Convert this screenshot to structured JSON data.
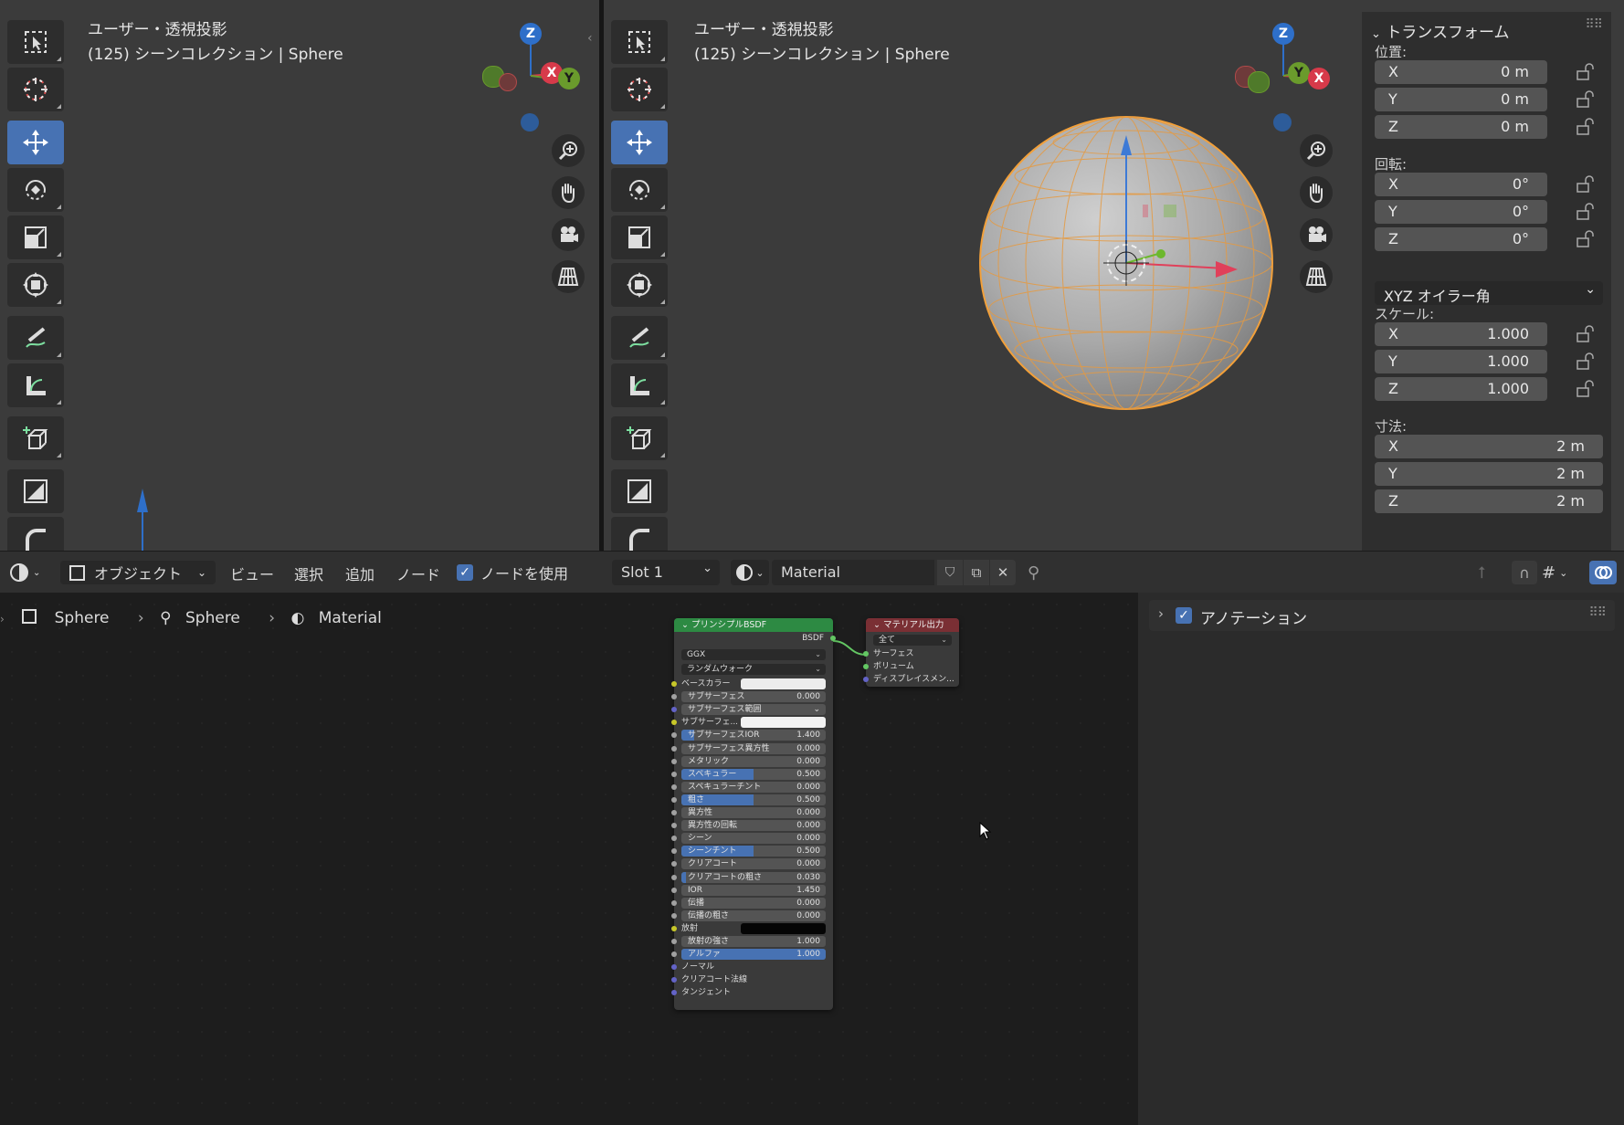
{
  "left_viewport": {
    "view_label": "ユーザー・透視投影",
    "collection_label": "(125) シーンコレクション | Sphere"
  },
  "right_viewport": {
    "view_label": "ユーザー・透視投影",
    "collection_label": "(125) シーンコレクション | Sphere"
  },
  "gizmo": {
    "z": "Z",
    "x": "X",
    "y": "Y"
  },
  "tools": [
    "select-box-icon",
    "cursor-icon",
    "move-icon",
    "rotate-icon",
    "scale-icon",
    "transform-icon",
    "annotate-icon",
    "measure-icon",
    "add-cube-icon",
    "shrink-icon",
    "bevel-icon"
  ],
  "nav_buttons": [
    "zoom-icon",
    "pan-hand-icon",
    "camera-icon",
    "perspective-grid-icon"
  ],
  "transform_panel": {
    "title": "トランスフォーム",
    "location_label": "位置:",
    "location": [
      {
        "axis": "X",
        "value": "0 m"
      },
      {
        "axis": "Y",
        "value": "0 m"
      },
      {
        "axis": "Z",
        "value": "0 m"
      }
    ],
    "rotation_label": "回転:",
    "rotation": [
      {
        "axis": "X",
        "value": "0°"
      },
      {
        "axis": "Y",
        "value": "0°"
      },
      {
        "axis": "Z",
        "value": "0°"
      }
    ],
    "rotation_mode": "XYZ オイラー角",
    "scale_label": "スケール:",
    "scale": [
      {
        "axis": "X",
        "value": "1.000"
      },
      {
        "axis": "Y",
        "value": "1.000"
      },
      {
        "axis": "Z",
        "value": "1.000"
      }
    ],
    "dimensions_label": "寸法:",
    "dimensions": [
      {
        "axis": "X",
        "value": "2 m"
      },
      {
        "axis": "Y",
        "value": "2 m"
      },
      {
        "axis": "Z",
        "value": "2 m"
      }
    ]
  },
  "node_header": {
    "object_mode": "オブジェクト",
    "menu": [
      "ビュー",
      "選択",
      "追加",
      "ノード"
    ],
    "use_nodes_label": "ノードを使用",
    "use_nodes_checked": true,
    "slot": "Slot 1",
    "material_name": "Material"
  },
  "breadcrumb": {
    "object": "Sphere",
    "mesh": "Sphere",
    "material": "Material"
  },
  "annotation_panel": {
    "label": "アノテーション",
    "checked": true
  },
  "bsdf_node": {
    "title": "プリンシプルBSDF",
    "output": "BSDF",
    "distribution": "GGX",
    "subsurface_method": "ランダムウォーク",
    "inputs": [
      {
        "label": "ベースカラー",
        "kind": "color",
        "color": "#ececec"
      },
      {
        "label": "サブサーフェス",
        "kind": "value",
        "value": "0.000",
        "fill": 0
      },
      {
        "label": "サブサーフェス範囲",
        "kind": "select"
      },
      {
        "label": "サブサーフェ...",
        "kind": "color",
        "color": "#f2f2f2"
      },
      {
        "label": "サブサーフェスIOR",
        "kind": "value",
        "value": "1.400",
        "fill": 0.09
      },
      {
        "label": "サブサーフェス異方性",
        "kind": "value",
        "value": "0.000",
        "fill": 0
      },
      {
        "label": "メタリック",
        "kind": "value",
        "value": "0.000",
        "fill": 0
      },
      {
        "label": "スペキュラー",
        "kind": "value",
        "value": "0.500",
        "fill": 0.5
      },
      {
        "label": "スペキュラーチント",
        "kind": "value",
        "value": "0.000",
        "fill": 0
      },
      {
        "label": "粗さ",
        "kind": "value",
        "value": "0.500",
        "fill": 0.5
      },
      {
        "label": "異方性",
        "kind": "value",
        "value": "0.000",
        "fill": 0
      },
      {
        "label": "異方性の回転",
        "kind": "value",
        "value": "0.000",
        "fill": 0
      },
      {
        "label": "シーン",
        "kind": "value",
        "value": "0.000",
        "fill": 0
      },
      {
        "label": "シーンチント",
        "kind": "value",
        "value": "0.500",
        "fill": 0.5
      },
      {
        "label": "クリアコート",
        "kind": "value",
        "value": "0.000",
        "fill": 0
      },
      {
        "label": "クリアコートの粗さ",
        "kind": "value",
        "value": "0.030",
        "fill": 0.03
      },
      {
        "label": "IOR",
        "kind": "value",
        "value": "1.450",
        "fill": 0
      },
      {
        "label": "伝播",
        "kind": "value",
        "value": "0.000",
        "fill": 0
      },
      {
        "label": "伝播の粗さ",
        "kind": "value",
        "value": "0.000",
        "fill": 0
      },
      {
        "label": "放射",
        "kind": "color",
        "color": "#050505"
      },
      {
        "label": "放射の強さ",
        "kind": "value",
        "value": "1.000",
        "fill": 0
      },
      {
        "label": "アルファ",
        "kind": "value",
        "value": "1.000",
        "fill": 1
      },
      {
        "label": "ノーマル",
        "kind": "plain"
      },
      {
        "label": "クリアコート法線",
        "kind": "plain"
      },
      {
        "label": "タンジェント",
        "kind": "plain"
      }
    ]
  },
  "output_node": {
    "title": "マテリアル出力",
    "target": "全て",
    "inputs": [
      "サーフェス",
      "ボリューム",
      "ディスプレイスメン..."
    ]
  }
}
